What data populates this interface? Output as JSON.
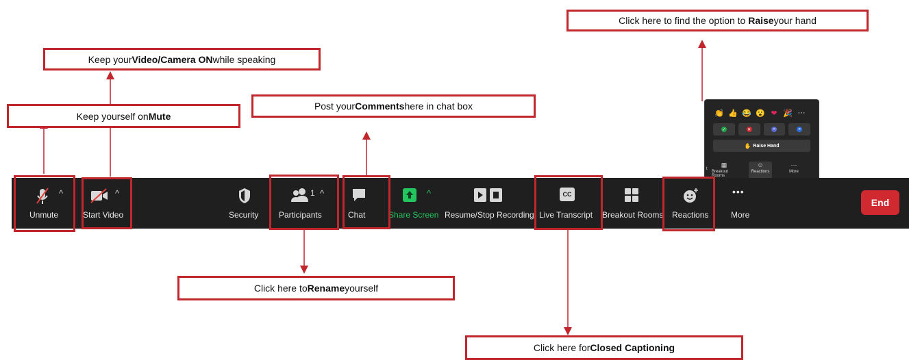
{
  "callouts": {
    "raise": {
      "before": "Click here to find the option to ",
      "bold": "Raise",
      "after": " your hand"
    },
    "video": {
      "before": "Keep your ",
      "bold": "Video/Camera ON",
      "after": " while speaking"
    },
    "mute": {
      "before": "Keep yourself on ",
      "bold": "Mute",
      "after": ""
    },
    "comments": {
      "before": "Post your ",
      "bold": "Comments",
      "after": " here in chat box"
    },
    "rename": {
      "before": "Click here to ",
      "bold": "Rename",
      "after": " yourself"
    },
    "captioning": {
      "before": "Click here for ",
      "bold": "Closed Captioning",
      "after": ""
    }
  },
  "toolbar": {
    "unmute": "Unmute",
    "start_video": "Start Video",
    "security": "Security",
    "participants": "Participants",
    "participants_count": "1",
    "chat": "Chat",
    "share_screen": "Share Screen",
    "recording": "Resume/Stop Recording",
    "live_transcript": "Live Transcript",
    "cc_glyph": "CC",
    "breakout_rooms": "Breakout Rooms",
    "reactions": "Reactions",
    "more": "More",
    "end": "End",
    "caret": "^",
    "more_glyph": "•••"
  },
  "reactions_popup": {
    "emojis": [
      "👏",
      "👍",
      "😂",
      "😮",
      "❤",
      "🎉",
      "···"
    ],
    "raise_hand": "Raise Hand",
    "mini_bar": {
      "partial": "t",
      "breakout": "Breakout Rooms",
      "reactions": "Reactions",
      "more": "More"
    }
  },
  "colors": {
    "accent_red": "#c0262c",
    "toolbar_bg": "#1f1f1f",
    "share_green": "#22c55e",
    "end_red": "#d0292f"
  }
}
